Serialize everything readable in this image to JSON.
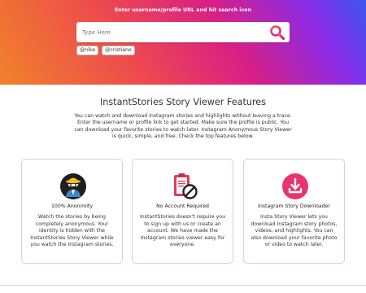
{
  "hero": {
    "title": "Enter username/profile URL and hit search icon",
    "search": {
      "placeholder": "Type Here",
      "value": ""
    },
    "tags": [
      "@nike",
      "@cristiano"
    ]
  },
  "features": {
    "title": "InstantStories Story Viewer Features",
    "description": "You can watch and download Instagram stories and highlights without leaving a trace. Enter the username or profile link to get started. Make sure the profile is public. You can download your favorite stories to watch later. Instagram Anonymous Story Viewer is quick, simple, and free. Check the top features below.",
    "cards": [
      {
        "title": "100% Anonimity",
        "icon": "spy-icon",
        "text": "Watch the stories by being completely anonymous. Your identity is hidden with the InstantStories Story Viewer while you watch the Instagram stories."
      },
      {
        "title": "No Account Required",
        "icon": "no-account-clipboard-icon",
        "text": "InstantStories doesn't require you to sign up with us or create an account. We have made the Instagram stories viewer easy for everyone."
      },
      {
        "title": "Instagram Story Downloader",
        "icon": "download-icon",
        "text": "Insta Story Viewer lets you download Instagram story photos, videos, and highlights. You can also download your favorite photo or video to watch later."
      }
    ]
  },
  "colors": {
    "gradient": [
      "#f0822a",
      "#ee4a4e",
      "#d81f86",
      "#8a2ce8",
      "#3b57ee"
    ],
    "accent": "#e8336f"
  }
}
